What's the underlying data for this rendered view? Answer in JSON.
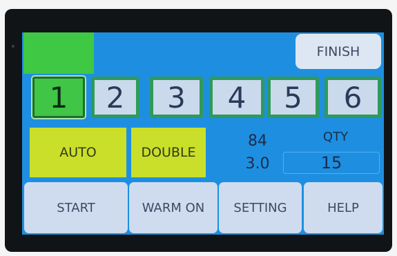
{
  "top_bar": {
    "finish_label": "FINISH",
    "status_color": "#3ec843"
  },
  "channels": {
    "active": "1",
    "items": [
      {
        "label": "1"
      },
      {
        "label": "2"
      },
      {
        "label": "3"
      },
      {
        "label": "4"
      },
      {
        "label": "5"
      },
      {
        "label": "6"
      }
    ]
  },
  "mode": {
    "auto_label": "AUTO",
    "double_label": "DOUBLE"
  },
  "readouts": {
    "value_1": "84",
    "value_2": "3.0",
    "qty_label": "QTY",
    "qty_value": "15"
  },
  "function_bar": {
    "start_label": "START",
    "warm_label": "WARM ON",
    "setting_label": "SETTING",
    "help_label": "HELP"
  },
  "colors": {
    "screen_background": "#1e8fe0",
    "mode_button": "#c9df2a",
    "active_channel": "#40c546",
    "channel_border": "#2f9a5a"
  }
}
